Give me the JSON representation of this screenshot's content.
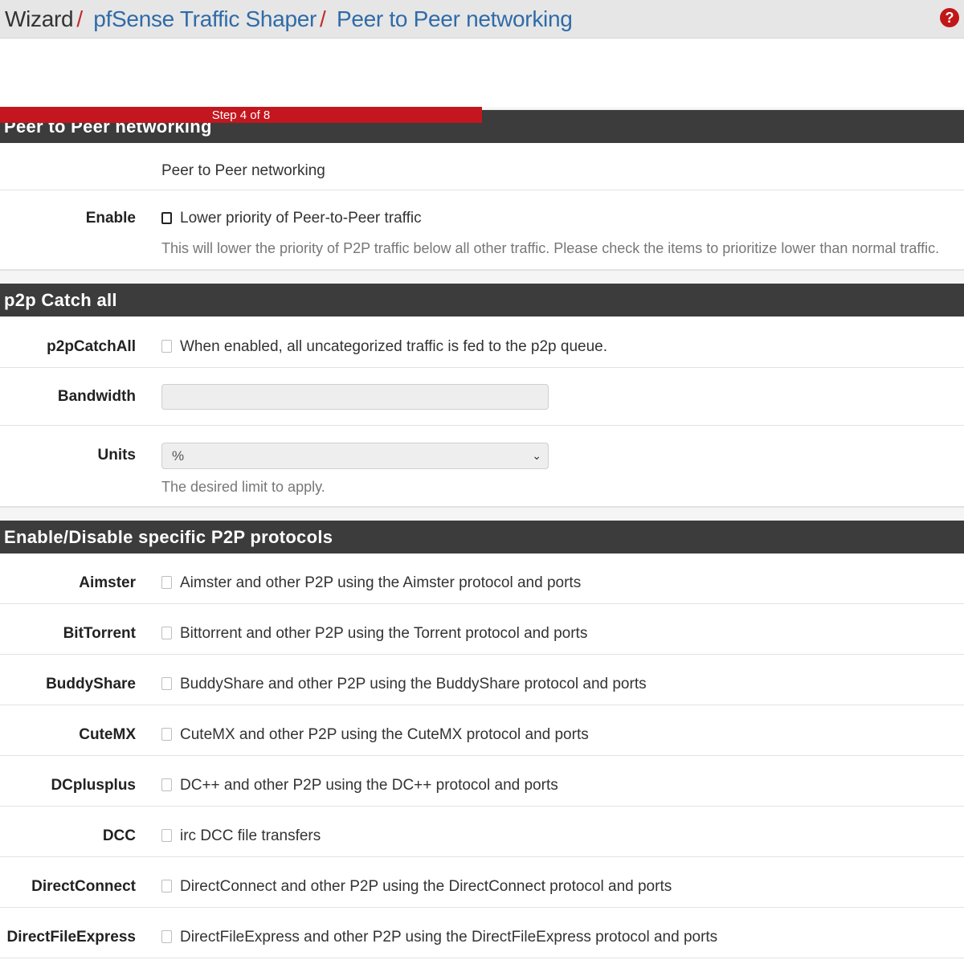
{
  "breadcrumb": {
    "root": "Wizard",
    "link1": "pfSense Traffic Shaper",
    "link2": "Peer to Peer networking",
    "separator": "/"
  },
  "help_icon": "question-circle-icon",
  "progress": {
    "label": "Step 4 of 8",
    "fraction": 0.5,
    "color": "#c3161e"
  },
  "sections": {
    "p2p": {
      "title": "Peer to Peer networking",
      "description": "Peer to Peer networking",
      "enable_label": "Enable",
      "enable_text": "Lower priority of Peer-to-Peer traffic",
      "enable_hint": "This will lower the priority of P2P traffic below all other traffic. Please check the items to prioritize lower than normal traffic."
    },
    "catchall": {
      "title": "p2p Catch all",
      "catchall_label": "p2pCatchAll",
      "catchall_text": "When enabled, all uncategorized traffic is fed to the p2p queue.",
      "bandwidth_label": "Bandwidth",
      "bandwidth_value": "",
      "units_label": "Units",
      "units_value": "%",
      "units_hint": "The desired limit to apply."
    },
    "protocols": {
      "title": "Enable/Disable specific P2P protocols",
      "items": [
        {
          "label": "Aimster",
          "text": "Aimster and other P2P using the Aimster protocol and ports"
        },
        {
          "label": "BitTorrent",
          "text": "Bittorrent and other P2P using the Torrent protocol and ports"
        },
        {
          "label": "BuddyShare",
          "text": "BuddyShare and other P2P using the BuddyShare protocol and ports"
        },
        {
          "label": "CuteMX",
          "text": "CuteMX and other P2P using the CuteMX protocol and ports"
        },
        {
          "label": "DCplusplus",
          "text": "DC++ and other P2P using the DC++ protocol and ports"
        },
        {
          "label": "DCC",
          "text": "irc DCC file transfers"
        },
        {
          "label": "DirectConnect",
          "text": "DirectConnect and other P2P using the DirectConnect protocol and ports"
        },
        {
          "label": "DirectFileExpress",
          "text": "DirectFileExpress and other P2P using the DirectFileExpress protocol and ports"
        }
      ]
    }
  }
}
